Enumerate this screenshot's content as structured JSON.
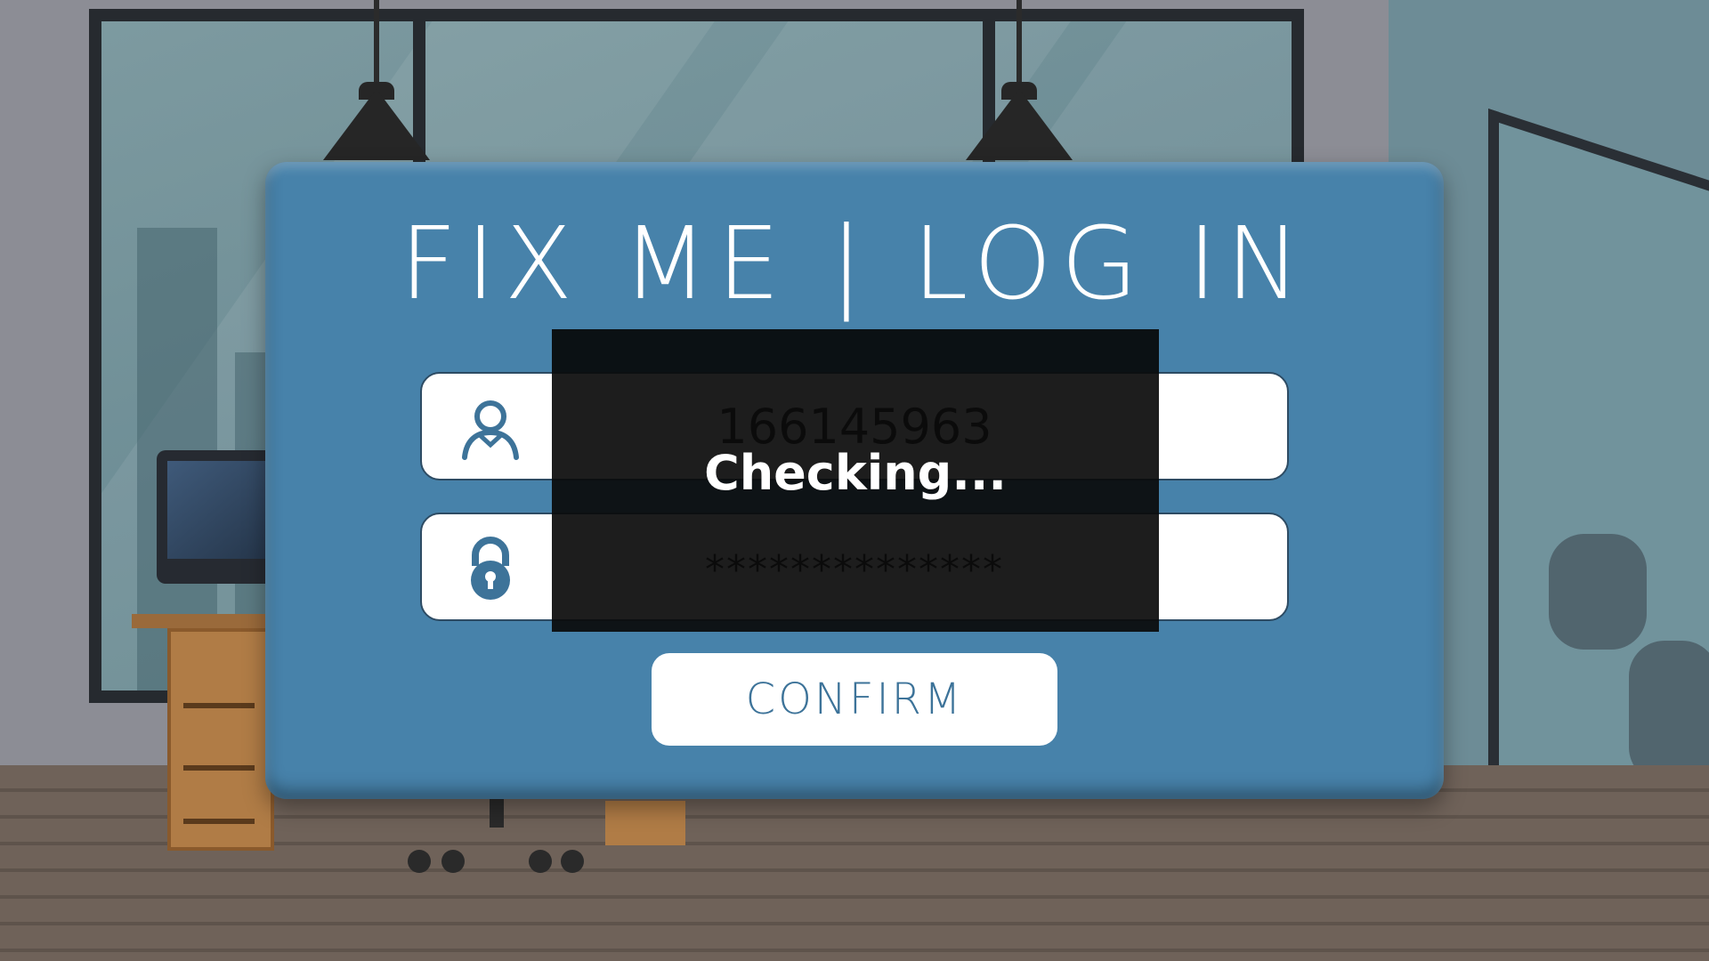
{
  "panel": {
    "title": "FIX ME | LOG IN",
    "username": {
      "icon": "user-icon",
      "value": "166145963"
    },
    "password": {
      "icon": "lock-icon",
      "value": "**************"
    },
    "confirm_label": "CONFIRM"
  },
  "overlay": {
    "label": "Checking..."
  },
  "colors": {
    "panel": "#4782aa",
    "field": "#ffffff",
    "icon": "#3d7399",
    "overlay": "#0a0a0a"
  }
}
